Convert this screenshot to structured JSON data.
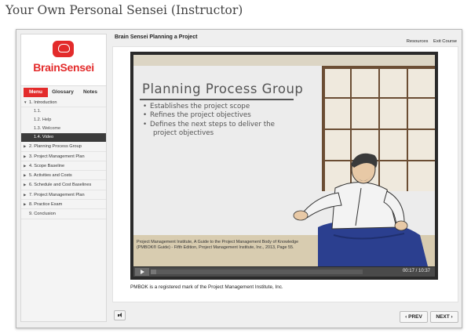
{
  "page_heading": "Your Own Personal Sensei (Instructor)",
  "logo": {
    "text": "BrainSensei",
    "icon": "brain-logo-icon"
  },
  "tabs": [
    {
      "label": "Menu"
    },
    {
      "label": "Glossary"
    },
    {
      "label": "Notes"
    }
  ],
  "menu": {
    "intro": "1. Introduction",
    "intro_sub": [
      {
        "label": "1.1."
      },
      {
        "label": "1.2. Help"
      },
      {
        "label": "1.3. Welcome"
      },
      {
        "label": "1.4. Video"
      }
    ],
    "items": [
      {
        "label": "2. Planning Process Group"
      },
      {
        "label": "3. Project Management Plan"
      },
      {
        "label": "4. Scope Baseline"
      },
      {
        "label": "5. Activities and Costs"
      },
      {
        "label": "6. Schedule and Cost Baselines"
      },
      {
        "label": "7. Project Management Plan"
      },
      {
        "label": "8. Practice Exam"
      },
      {
        "label": "9. Conclusion"
      }
    ]
  },
  "content_title": "Brain Sensei Planning a Project",
  "top_links": {
    "resources": "Resources",
    "exit": "Exit Course"
  },
  "slide": {
    "title": "Planning Process Group",
    "bullets": [
      "Establishes the project scope",
      "Refines the project objectives",
      "Defines the next steps to deliver the"
    ],
    "bullet_continuation": "project objectives",
    "citation_line1": "Project Management Institute, A Guide to the Project Management Body of Knowledge",
    "citation_line2": "(PMBOK® Guide) - Fifth Edition, Project Management Institute, Inc., 2013, Page 55."
  },
  "player": {
    "time": "00:17 / 10:37",
    "progress_fraction": 0.027
  },
  "pmbok_note": "PMBOK is a registered mark of the Project Management Institute, Inc.",
  "nav": {
    "prev": "‹ PREV",
    "next": "NEXT ›"
  },
  "colors": {
    "brand_red": "#e32b2b",
    "active_menu": "#3b3b3b"
  }
}
